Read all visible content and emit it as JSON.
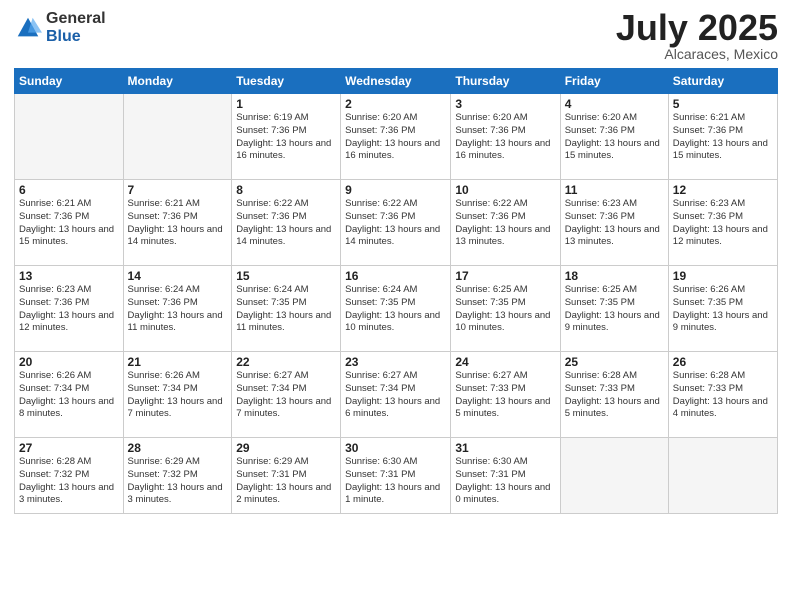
{
  "logo": {
    "general": "General",
    "blue": "Blue"
  },
  "title": "July 2025",
  "subtitle": "Alcaraces, Mexico",
  "days_of_week": [
    "Sunday",
    "Monday",
    "Tuesday",
    "Wednesday",
    "Thursday",
    "Friday",
    "Saturday"
  ],
  "weeks": [
    [
      {
        "day": "",
        "info": ""
      },
      {
        "day": "",
        "info": ""
      },
      {
        "day": "1",
        "info": "Sunrise: 6:19 AM\nSunset: 7:36 PM\nDaylight: 13 hours and 16 minutes."
      },
      {
        "day": "2",
        "info": "Sunrise: 6:20 AM\nSunset: 7:36 PM\nDaylight: 13 hours and 16 minutes."
      },
      {
        "day": "3",
        "info": "Sunrise: 6:20 AM\nSunset: 7:36 PM\nDaylight: 13 hours and 16 minutes."
      },
      {
        "day": "4",
        "info": "Sunrise: 6:20 AM\nSunset: 7:36 PM\nDaylight: 13 hours and 15 minutes."
      },
      {
        "day": "5",
        "info": "Sunrise: 6:21 AM\nSunset: 7:36 PM\nDaylight: 13 hours and 15 minutes."
      }
    ],
    [
      {
        "day": "6",
        "info": "Sunrise: 6:21 AM\nSunset: 7:36 PM\nDaylight: 13 hours and 15 minutes."
      },
      {
        "day": "7",
        "info": "Sunrise: 6:21 AM\nSunset: 7:36 PM\nDaylight: 13 hours and 14 minutes."
      },
      {
        "day": "8",
        "info": "Sunrise: 6:22 AM\nSunset: 7:36 PM\nDaylight: 13 hours and 14 minutes."
      },
      {
        "day": "9",
        "info": "Sunrise: 6:22 AM\nSunset: 7:36 PM\nDaylight: 13 hours and 14 minutes."
      },
      {
        "day": "10",
        "info": "Sunrise: 6:22 AM\nSunset: 7:36 PM\nDaylight: 13 hours and 13 minutes."
      },
      {
        "day": "11",
        "info": "Sunrise: 6:23 AM\nSunset: 7:36 PM\nDaylight: 13 hours and 13 minutes."
      },
      {
        "day": "12",
        "info": "Sunrise: 6:23 AM\nSunset: 7:36 PM\nDaylight: 13 hours and 12 minutes."
      }
    ],
    [
      {
        "day": "13",
        "info": "Sunrise: 6:23 AM\nSunset: 7:36 PM\nDaylight: 13 hours and 12 minutes."
      },
      {
        "day": "14",
        "info": "Sunrise: 6:24 AM\nSunset: 7:36 PM\nDaylight: 13 hours and 11 minutes."
      },
      {
        "day": "15",
        "info": "Sunrise: 6:24 AM\nSunset: 7:35 PM\nDaylight: 13 hours and 11 minutes."
      },
      {
        "day": "16",
        "info": "Sunrise: 6:24 AM\nSunset: 7:35 PM\nDaylight: 13 hours and 10 minutes."
      },
      {
        "day": "17",
        "info": "Sunrise: 6:25 AM\nSunset: 7:35 PM\nDaylight: 13 hours and 10 minutes."
      },
      {
        "day": "18",
        "info": "Sunrise: 6:25 AM\nSunset: 7:35 PM\nDaylight: 13 hours and 9 minutes."
      },
      {
        "day": "19",
        "info": "Sunrise: 6:26 AM\nSunset: 7:35 PM\nDaylight: 13 hours and 9 minutes."
      }
    ],
    [
      {
        "day": "20",
        "info": "Sunrise: 6:26 AM\nSunset: 7:34 PM\nDaylight: 13 hours and 8 minutes."
      },
      {
        "day": "21",
        "info": "Sunrise: 6:26 AM\nSunset: 7:34 PM\nDaylight: 13 hours and 7 minutes."
      },
      {
        "day": "22",
        "info": "Sunrise: 6:27 AM\nSunset: 7:34 PM\nDaylight: 13 hours and 7 minutes."
      },
      {
        "day": "23",
        "info": "Sunrise: 6:27 AM\nSunset: 7:34 PM\nDaylight: 13 hours and 6 minutes."
      },
      {
        "day": "24",
        "info": "Sunrise: 6:27 AM\nSunset: 7:33 PM\nDaylight: 13 hours and 5 minutes."
      },
      {
        "day": "25",
        "info": "Sunrise: 6:28 AM\nSunset: 7:33 PM\nDaylight: 13 hours and 5 minutes."
      },
      {
        "day": "26",
        "info": "Sunrise: 6:28 AM\nSunset: 7:33 PM\nDaylight: 13 hours and 4 minutes."
      }
    ],
    [
      {
        "day": "27",
        "info": "Sunrise: 6:28 AM\nSunset: 7:32 PM\nDaylight: 13 hours and 3 minutes."
      },
      {
        "day": "28",
        "info": "Sunrise: 6:29 AM\nSunset: 7:32 PM\nDaylight: 13 hours and 3 minutes."
      },
      {
        "day": "29",
        "info": "Sunrise: 6:29 AM\nSunset: 7:31 PM\nDaylight: 13 hours and 2 minutes."
      },
      {
        "day": "30",
        "info": "Sunrise: 6:30 AM\nSunset: 7:31 PM\nDaylight: 13 hours and 1 minute."
      },
      {
        "day": "31",
        "info": "Sunrise: 6:30 AM\nSunset: 7:31 PM\nDaylight: 13 hours and 0 minutes."
      },
      {
        "day": "",
        "info": ""
      },
      {
        "day": "",
        "info": ""
      }
    ]
  ]
}
